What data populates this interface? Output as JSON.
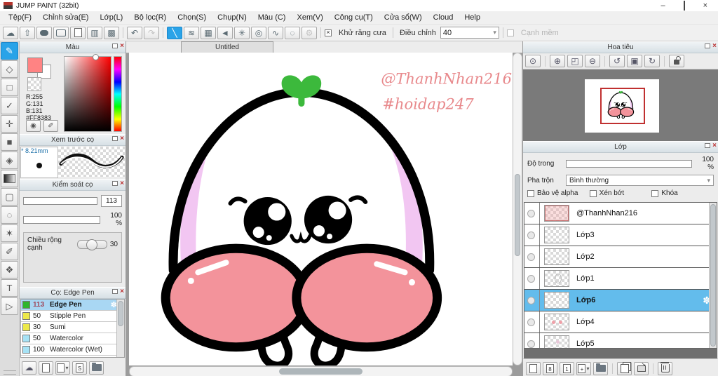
{
  "window": {
    "title": "JUMP PAINT (32bit)"
  },
  "menu": {
    "items": [
      "Tệp(F)",
      "Chỉnh sửa(E)",
      "Lớp(L)",
      "Bộ lọc(R)",
      "Chọn(S)",
      "Chụp(N)",
      "Màu (C)",
      "Xem(V)",
      "Công cụ(T)",
      "Cửa sổ(W)",
      "Cloud",
      "Help"
    ]
  },
  "toolbar": {
    "antialias": {
      "label": "Khử răng cưa",
      "checked": true
    },
    "adjust": {
      "label": "Điều chỉnh",
      "value": "40"
    },
    "soft_edge": {
      "label": "Cạnh mềm",
      "enabled": false
    }
  },
  "icons": {
    "minimize": "–",
    "close": "×",
    "check_mark": "×",
    "dropdown_arrow": "▾",
    "cloud": "☁",
    "share": "⇧",
    "panel_layout": "▥",
    "palette_edit": "▩",
    "undo": "↶",
    "redo": "↷",
    "line": "╲",
    "hatch": "≋",
    "grid": "▦",
    "focus_lines": "◄",
    "burst_lines": "✳",
    "concentric": "◎",
    "curve": "∿",
    "dashed_circle": "◌",
    "gear": "⚙",
    "brush": "✎",
    "eraser": "◇",
    "rect_tool": "□",
    "polyline": "✓",
    "move": "✛",
    "shape_fill": "■",
    "bucket": "◈",
    "select_rect": "▢",
    "lasso": "◌",
    "magic_wand": "✶",
    "select_pen": "✐",
    "select_eraser": "❖",
    "text_tool": "T",
    "select_shape": "▷",
    "color_wheel": "◉",
    "color_picker": "✐",
    "zoom_actual": "⊙",
    "zoom_in": "⊕",
    "zoom_fit": "◰",
    "zoom_out": "⊖",
    "rotate_ccw": "↺",
    "rotate_reset": "▣",
    "rotate_cw": "↻",
    "gear_badge": "✽",
    "page_add_label": "+",
    "page_8_label": "8",
    "page_1_label": "1",
    "page_s_label": "S"
  },
  "color_panel": {
    "title": "Màu",
    "r_label": "R:255",
    "g_label": "G:131",
    "b_label": "B:131",
    "hex": "#FF8383"
  },
  "brush_preview": {
    "title": "Xem trước cọ",
    "modified_mark": "*",
    "size_label": "8.21mm"
  },
  "brush_control": {
    "title": "Kiểm soát cọ",
    "size_value": "113",
    "opacity_value": "100 %",
    "edge_width_label": "Chiều rộng cạnh",
    "edge_width_value": "30"
  },
  "brush_panel": {
    "title": "Cọ: Edge Pen",
    "items": [
      {
        "size": "113",
        "name": "Edge Pen",
        "color": "#2DB52D",
        "selected": true
      },
      {
        "size": "50",
        "name": "Stipple Pen",
        "color": "#EDE94A",
        "selected": false
      },
      {
        "size": "30",
        "name": "Sumi",
        "color": "#EDE94A",
        "selected": false
      },
      {
        "size": "50",
        "name": "Watercolor",
        "color": "#A6E2F5",
        "selected": false
      },
      {
        "size": "100",
        "name": "Watercolor (Wet)",
        "color": "#A6E2F5",
        "selected": false
      }
    ]
  },
  "canvas": {
    "tab": "Untitled",
    "watermark_line1": "@ThanhNhan216",
    "watermark_line2": "#hoidap247"
  },
  "navigator": {
    "title": "Hoa tiêu"
  },
  "layers_panel": {
    "title": "Lớp",
    "opacity_label": "Độ trong",
    "opacity_value": "100 %",
    "blend_label": "Pha trộn",
    "blend_value": "Bình thường",
    "alpha_label": "Bảo vệ alpha",
    "clip_label": "Xén bớt",
    "lock_label": "Khóa",
    "items": [
      {
        "name": "@ThanhNhan216",
        "selected": false
      },
      {
        "name": "Lớp3",
        "selected": false
      },
      {
        "name": "Lớp2",
        "selected": false
      },
      {
        "name": "Lớp1",
        "selected": false
      },
      {
        "name": "Lớp6",
        "selected": true
      },
      {
        "name": "Lớp4",
        "selected": false
      },
      {
        "name": "Lớp5",
        "selected": false
      }
    ]
  },
  "colors": {
    "accent_blue": "#29A3E8",
    "layer_selected_blue": "#63BCEC",
    "brush_selected_blue": "#A9D7F3",
    "foreground_color": "#FF8383",
    "cheek_pink": "#F3939B",
    "lilac": "#F2C6F2",
    "sprout_green": "#3CB93C",
    "watermark_pink": "#E8898C",
    "thumb_border_red": "#C03030"
  }
}
